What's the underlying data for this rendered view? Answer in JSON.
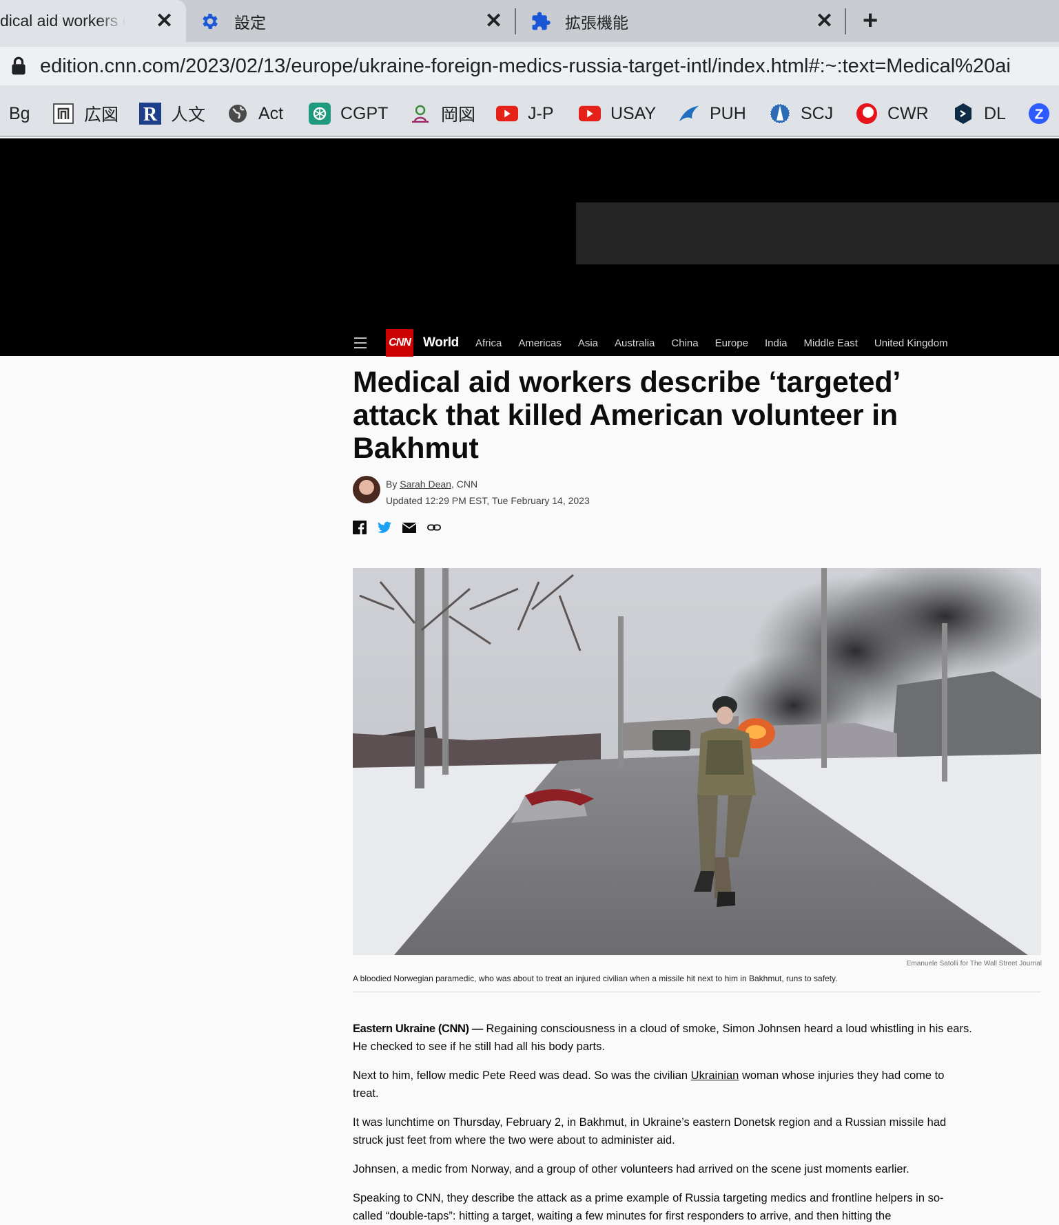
{
  "browser": {
    "tabs": [
      {
        "title": "Medical aid workers describe",
        "active": true
      },
      {
        "title": "設定",
        "icon": "gear-icon"
      },
      {
        "title": "拡張機能",
        "icon": "puzzle-icon"
      }
    ],
    "url": "edition.cnn.com/2023/02/13/europe/ukraine-foreign-medics-russia-target-intl/index.html#:~:text=Medical%20ai",
    "bookmarks": [
      "Bg",
      "広図",
      "人文",
      "Act",
      "CGPT",
      "岡図",
      "J-P",
      "USAY",
      "PUH",
      "SCJ",
      "CWR",
      "DL"
    ],
    "accent": "#1a73e8"
  },
  "site": {
    "logo": "CNN",
    "section": "World",
    "nav": [
      "Africa",
      "Americas",
      "Asia",
      "Australia",
      "China",
      "Europe",
      "India",
      "Middle East",
      "United Kingdom"
    ],
    "brand_color": "#cc0000"
  },
  "article": {
    "headline": "Medical aid workers describe ‘targeted’ attack that killed American volunteer in Bakhmut",
    "by_prefix": "By",
    "author": "Sarah Dean",
    "outlet_suffix": ", CNN",
    "updated": "Updated 12:29 PM EST, Tue February 14, 2023",
    "photo_credit": "Emanuele Satolli for The Wall Street Journal",
    "caption": "A bloodied Norwegian paramedic, who was about to treat an injured civilian when a missile hit next to him in Bakhmut, runs to safety.",
    "dateline": "Eastern Ukraine (CNN) —",
    "p1": "Regaining consciousness in a cloud of smoke, Simon Johnsen heard a loud whistling in his ears. He checked to see if he still had all his body parts.",
    "p2_before": "Next to him, fellow medic Pete Reed was dead. So was the civilian ",
    "p2_link": "Ukrainian",
    "p2_after": " woman whose injuries they had come to treat.",
    "p3": "It was lunchtime on Thursday, February 2, in Bakhmut, in Ukraine’s eastern Donetsk region and a Russian missile had struck just feet from where the two were about to administer aid.",
    "p4": "Johnsen, a medic from Norway, and a group of other volunteers had arrived on the scene just moments earlier.",
    "p5": "Speaking to CNN, they describe the attack as a prime example of Russia targeting medics and frontline helpers in so-called “double-taps”: hitting a target, waiting a few minutes for first responders to arrive, and then hitting the"
  }
}
